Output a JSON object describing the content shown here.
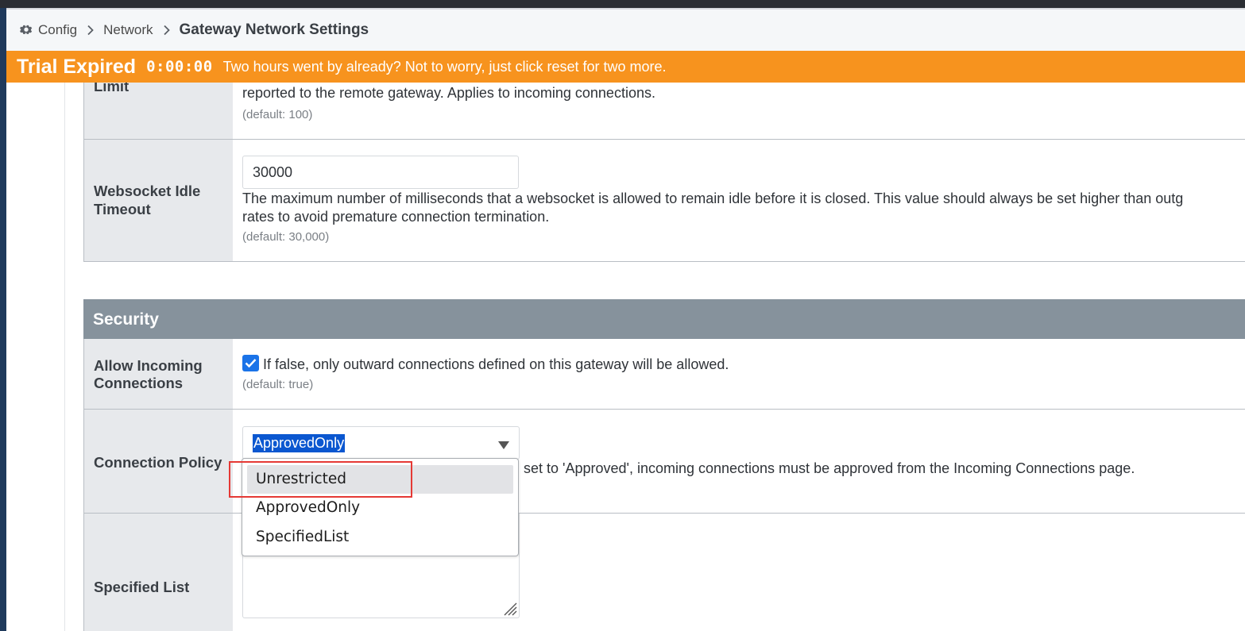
{
  "breadcrumb": {
    "items": [
      "Config",
      "Network"
    ],
    "current": "Gateway Network Settings",
    "icon": "gear-icon"
  },
  "trial_banner": {
    "title": "Trial Expired",
    "timer": "0:00:00",
    "message": "Two hours went by already? Not to worry, just click reset for two more.",
    "color": "#f7931e"
  },
  "rows": {
    "limit": {
      "label": "Limit",
      "desc": "reported to the remote gateway. Applies to incoming connections.",
      "default": "(default: 100)"
    },
    "websocket_idle": {
      "label_line1": "Websocket Idle",
      "label_line2": "Timeout",
      "value": "30000",
      "desc_line1": "The maximum number of milliseconds that a websocket is allowed to remain idle before it is closed. This value should always be set higher than outg",
      "desc_line2": "rates to avoid premature connection termination.",
      "default": "(default: 30,000)"
    }
  },
  "security": {
    "title": "Security",
    "allow_incoming": {
      "label_line1": "Allow Incoming",
      "label_line2": "Connections",
      "checked": true,
      "desc": "If false, only outward connections defined on this gateway will be allowed.",
      "default": "(default: true)"
    },
    "connection_policy": {
      "label": "Connection Policy",
      "selected": "ApprovedOnly",
      "desc_visible": "set to 'Approved', incoming connections must be approved from the Incoming Connections page.",
      "options": [
        "Unrestricted",
        "ApprovedOnly",
        "SpecifiedList"
      ],
      "highlighted_option": "Unrestricted"
    },
    "specified_list": {
      "label": "Specified List"
    }
  },
  "colors": {
    "section_header": "#86929c",
    "label_bg": "#e7e9ec",
    "checkbox": "#1a73e8",
    "selection": "#0b57d0",
    "annotation_box": "#e53935"
  }
}
